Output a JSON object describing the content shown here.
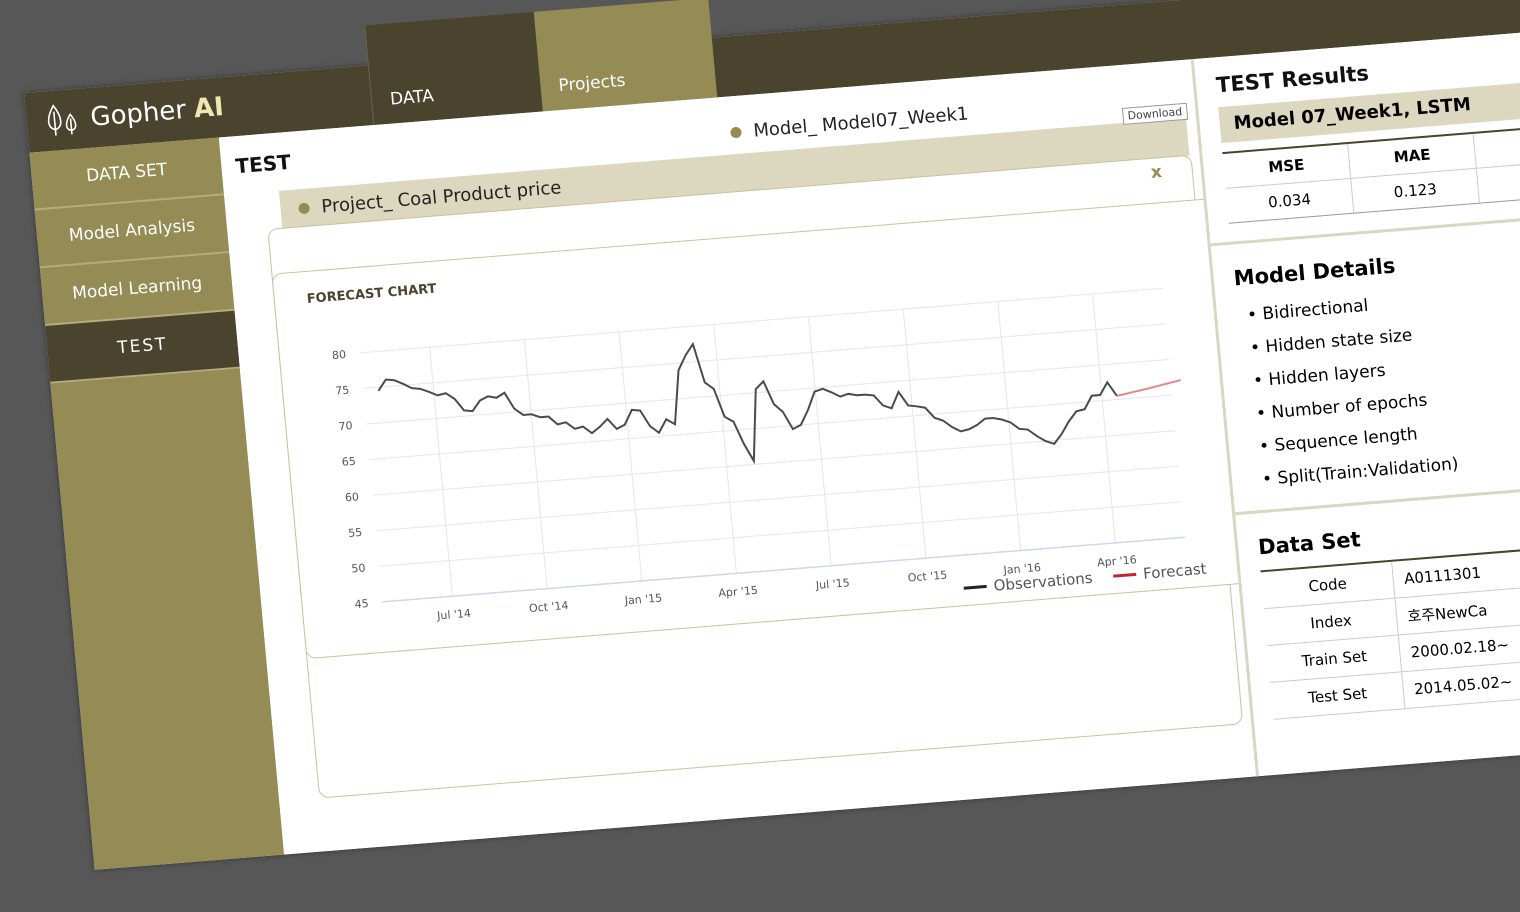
{
  "logo": {
    "name": "Gopher",
    "ai": "AI"
  },
  "nav": {
    "data": "DATA",
    "projects": "Projects"
  },
  "sidebar": {
    "items": [
      {
        "label": "DATA SET"
      },
      {
        "label": "Model Analysis"
      },
      {
        "label": "Model Learning"
      },
      {
        "label": "TEST"
      }
    ]
  },
  "main": {
    "title": "TEST",
    "project": "Project_  Coal Product price",
    "model": "Model_  Model07_Week1",
    "download": "Download",
    "close": "x"
  },
  "chart": {
    "title": "FORECAST CHART",
    "legend_obs": "Observations",
    "legend_forecast": "Forecast",
    "yticks": [
      "80",
      "75",
      "70",
      "65",
      "60",
      "55",
      "50",
      "45"
    ],
    "xticks": [
      "Jul '14",
      "Oct '14",
      "Jan '15",
      "Apr '15",
      "Jul '15",
      "Oct '15",
      "Jan '16",
      "Apr '16"
    ]
  },
  "chart_data": {
    "type": "line",
    "title": "FORECAST CHART",
    "ylim": [
      45,
      80
    ],
    "x_labels": [
      "Jul '14",
      "Oct '14",
      "Jan '15",
      "Apr '15",
      "Jul '15",
      "Oct '15",
      "Jan '16",
      "Apr '16"
    ],
    "series": [
      {
        "name": "Observations",
        "color": "#4a4a55",
        "values": [
          74.5,
          76,
          75.8,
          75.2,
          74.5,
          74.3,
          73.8,
          73.2,
          73.4,
          72.5,
          70.8,
          70.6,
          72,
          72.5,
          72.2,
          72.8,
          70.5,
          69.5,
          69.5,
          69,
          69,
          67.8,
          68,
          67,
          67.2,
          66.2,
          67,
          68,
          66.5,
          67,
          69,
          68.8,
          66.5,
          65.5,
          67.3,
          66.5,
          74,
          76,
          77.5,
          72,
          71,
          67,
          66.2,
          63,
          60.5,
          70.5,
          71.5,
          68.2,
          67,
          64.5,
          65,
          67,
          69.5,
          69.8,
          69.2,
          68.5,
          68.8,
          68.5,
          68.5,
          68.3,
          66.8,
          66.3,
          68.5,
          66.5,
          66.3,
          66,
          64.5,
          64,
          63,
          62.3,
          62.5,
          63,
          63.8,
          63.8,
          63.5,
          63,
          62,
          61.8,
          60.8,
          60,
          59.5,
          60.8,
          62.5,
          63.8,
          64,
          65.8,
          65.8,
          67.5,
          65.5
        ]
      },
      {
        "name": "Forecast",
        "color": "#e8868a",
        "values": [
          65.5,
          66.2,
          67
        ]
      }
    ]
  },
  "right": {
    "title": "TEST Results",
    "model": "Model 07_Week1, LSTM",
    "metrics": {
      "headers": [
        "MSE",
        "MAE"
      ],
      "values": [
        "0.034",
        "0.123"
      ]
    },
    "details_title": "Model Details",
    "details": [
      "Bidirectional",
      "Hidden state size",
      "Hidden layers",
      "Number of epochs",
      "Sequence length",
      "Split(Train:Validation)"
    ],
    "dataset_title": "Data Set",
    "dataset": [
      {
        "key": "Code",
        "value": "A0111301"
      },
      {
        "key": "Index",
        "value": "호주NewCa"
      },
      {
        "key": "Train Set",
        "value": "2000.02.18~"
      },
      {
        "key": "Test Set",
        "value": "2014.05.02~"
      }
    ]
  },
  "colors": {
    "dark": "#4a432e",
    "olive": "#958b55",
    "sand": "#dcd8c0",
    "obs": "#4a4a55",
    "forecast": "#e8868a"
  }
}
